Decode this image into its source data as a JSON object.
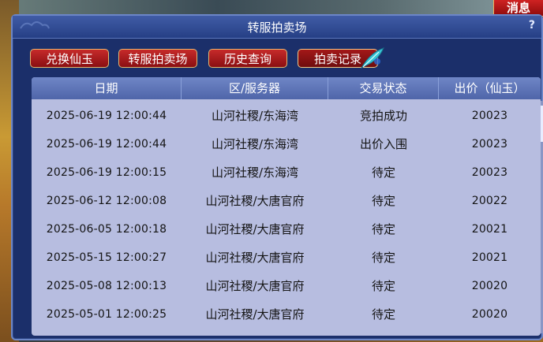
{
  "top_right_button": "消息",
  "window": {
    "title": "转服拍卖场",
    "help": "?"
  },
  "tabs": [
    {
      "label": "兑换仙玉"
    },
    {
      "label": "转服拍卖场"
    },
    {
      "label": "历史查询"
    },
    {
      "label": "拍卖记录",
      "active": true
    }
  ],
  "table": {
    "headers": [
      "日期",
      "区/服务器",
      "交易状态",
      "出价（仙玉）"
    ],
    "rows": [
      [
        "2025-06-19 12:00:44",
        "山河社稷/东海湾",
        "竞拍成功",
        "20023"
      ],
      [
        "2025-06-19 12:00:44",
        "山河社稷/东海湾",
        "出价入围",
        "20023"
      ],
      [
        "2025-06-19 12:00:15",
        "山河社稷/东海湾",
        "待定",
        "20023"
      ],
      [
        "2025-06-12 12:00:08",
        "山河社稷/大唐官府",
        "待定",
        "20022"
      ],
      [
        "2025-06-05 12:00:18",
        "山河社稷/大唐官府",
        "待定",
        "20021"
      ],
      [
        "2025-05-15 12:00:27",
        "山河社稷/大唐官府",
        "待定",
        "20021"
      ],
      [
        "2025-05-08 12:00:13",
        "山河社稷/大唐官府",
        "待定",
        "20020"
      ],
      [
        "2025-05-01 12:00:25",
        "山河社稷/大唐官府",
        "待定",
        "20020"
      ]
    ]
  },
  "scroll": {
    "position": 0.0
  },
  "icons": {
    "feather": "quill-feather-icon"
  },
  "colors": {
    "tab_red": "#c62a2a",
    "panel_blue": "#1b2f6a",
    "row_bg": "#b7bde0"
  }
}
